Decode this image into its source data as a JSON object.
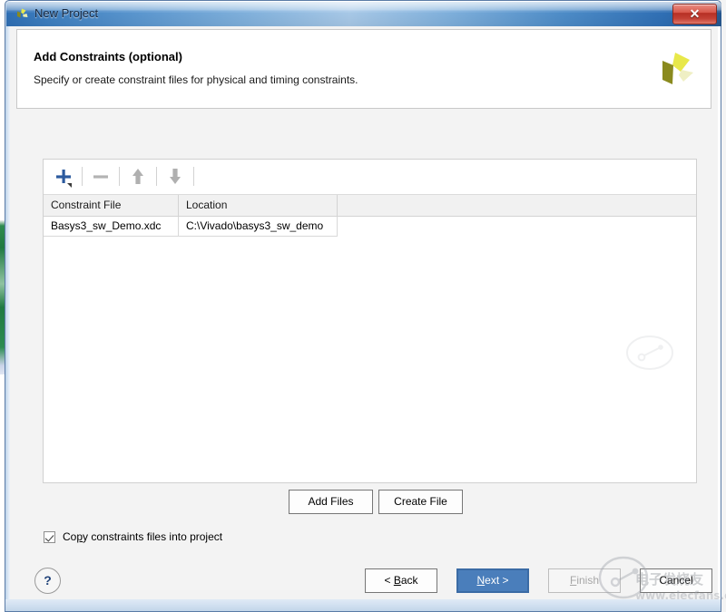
{
  "window": {
    "title": "New Project",
    "icon": "vivado-pinwheel-icon",
    "close_label": "✕"
  },
  "header": {
    "title": "Add Constraints (optional)",
    "subtitle": "Specify or create constraint files for physical and timing constraints.",
    "logo": "vivado-pinwheel-logo"
  },
  "toolbar": {
    "buttons": [
      {
        "name": "add-constraint-file-button",
        "icon": "plus-icon",
        "tooltip": "Add Files"
      },
      {
        "name": "remove-constraint-file-button",
        "icon": "minus-icon",
        "tooltip": "Remove"
      },
      {
        "name": "move-up-button",
        "icon": "arrow-up-icon",
        "tooltip": "Move Up"
      },
      {
        "name": "move-down-button",
        "icon": "arrow-down-icon",
        "tooltip": "Move Down"
      }
    ]
  },
  "table": {
    "columns": [
      "Constraint File",
      "Location"
    ],
    "rows": [
      {
        "constraint_file": "Basys3_sw_Demo.xdc",
        "location": "C:\\Vivado\\basys3_sw_demo"
      }
    ]
  },
  "actions": {
    "add_files_label": "Add Files",
    "create_file_label": "Create File"
  },
  "copy_option": {
    "label_before": "Co",
    "label_mnemonic": "p",
    "label_after": "y constraints files into project",
    "checked": true
  },
  "footer": {
    "help_label": "?",
    "back_before": "< ",
    "back_mnemonic": "B",
    "back_after": "ack",
    "next_mnemonic": "N",
    "next_after": "ext >",
    "finish_mnemonic": "F",
    "finish_after": "inish",
    "cancel_label": "Cancel"
  },
  "watermark": {
    "chinese": "电子发烧友",
    "url": "www.elecfans.com"
  },
  "colors": {
    "title_gradient_start": "#2f6fb5",
    "title_gradient_mid": "#a8c9e8",
    "close_red": "#b62f24",
    "next_blue": "#4a7ebb",
    "logo_yellow": "#e8e84a",
    "logo_olive": "#8a8a1e",
    "help_blue": "#22447a",
    "backdrop_green": "#1f7a42"
  }
}
